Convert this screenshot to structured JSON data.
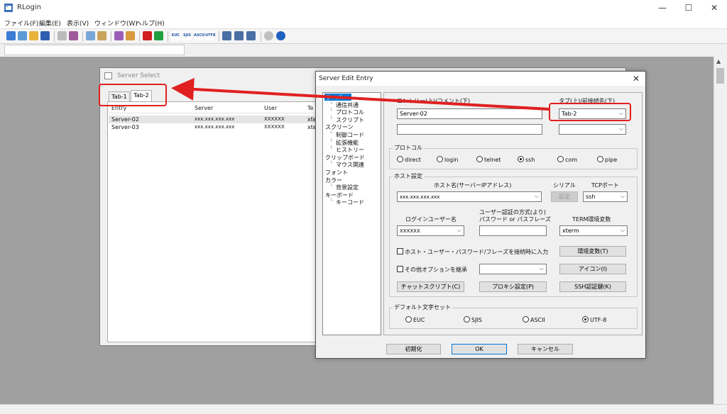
{
  "app": {
    "title": "RLogin",
    "menu": [
      "ファイル(F)",
      "編集(E)",
      "表示(V)",
      "ウィンドウ(W)",
      "ヘルプ(H)"
    ],
    "window_controls": {
      "minimize": "—",
      "maximize": "☐",
      "close": "✕"
    }
  },
  "toolbar": {
    "buttons": [
      {
        "icon": "new-connection-icon",
        "color": "#3a7bd5"
      },
      {
        "icon": "quick-connect-icon",
        "color": "#5b9bd5"
      },
      {
        "icon": "open-folder-icon",
        "color": "#e8b33c"
      },
      {
        "icon": "save-icon",
        "color": "#2f5fb3"
      },
      {
        "icon": "new-document-icon",
        "color": "#bbbbbb"
      },
      {
        "icon": "disconnect-icon",
        "color": "#a05a9c"
      },
      {
        "icon": "copy-icon",
        "color": "#7aa7d8"
      },
      {
        "icon": "paste-icon",
        "color": "#c8a45a"
      },
      {
        "icon": "script-icon",
        "color": "#9c5fb5"
      },
      {
        "icon": "keyboard-icon",
        "color": "#d89a3c"
      },
      {
        "icon": "stop-icon",
        "color": "#d02020"
      },
      {
        "icon": "play-icon",
        "color": "#20a040"
      }
    ],
    "charset_buttons": [
      "EUC",
      "SJIS",
      "ASCII",
      "UTF8"
    ],
    "view_buttons": [
      {
        "icon": "window-icon",
        "color": "#4a6fa5"
      },
      {
        "icon": "split-window-icon",
        "color": "#4a6fa5"
      },
      {
        "icon": "tile-window-icon",
        "color": "#4a6fa5"
      }
    ],
    "misc_buttons": [
      {
        "icon": "settings-icon",
        "color": "#c0c0c0"
      },
      {
        "icon": "help-icon",
        "color": "#2060c0"
      }
    ]
  },
  "server_select": {
    "title": "Server Select",
    "tabs": [
      "Tab-1",
      "Tab-2"
    ],
    "columns": [
      "Entry",
      "Server",
      "User",
      "Te"
    ],
    "rows": [
      {
        "entry": "Server-02",
        "server": "xxx.xxx.xxx.xxx",
        "user": "XXXXXX",
        "term": "xte"
      },
      {
        "entry": "Server-03",
        "server": "xxx.xxx.xxx.xxx",
        "user": "XXXXXX",
        "term": "xte"
      }
    ]
  },
  "edit_dialog": {
    "title": "Server Edit Entry",
    "close": "✕",
    "tree": [
      {
        "label": "サーバー",
        "level": 0
      },
      {
        "label": "通信共通",
        "level": 1
      },
      {
        "label": "プロトコル",
        "level": 1
      },
      {
        "label": "スクリプト",
        "level": 1
      },
      {
        "label": "スクリーン",
        "level": 0
      },
      {
        "label": "制御コード",
        "level": 1
      },
      {
        "label": "拡張機能",
        "level": 1
      },
      {
        "label": "ヒストリー",
        "level": 1
      },
      {
        "label": "クリップボード",
        "level": 0
      },
      {
        "label": "マウス関連",
        "level": 1
      },
      {
        "label": "フォント",
        "level": 0
      },
      {
        "label": "カラー",
        "level": 0
      },
      {
        "label": "背景設定",
        "level": 1
      },
      {
        "label": "キーボード",
        "level": 0
      },
      {
        "label": "キーコード",
        "level": 1
      }
    ],
    "entry_label": "エントリー(上)/コメント(下)",
    "entry_value": "Server-02",
    "comment_value": "",
    "tab_label": "タブ(上)/前接続先(下)",
    "tab_value": "Tab-2",
    "prev_value": "",
    "protocol_group": "プロトコル",
    "protocols": [
      {
        "label": "direct",
        "checked": false
      },
      {
        "label": "login",
        "checked": false
      },
      {
        "label": "telnet",
        "checked": false
      },
      {
        "label": "ssh",
        "checked": true
      },
      {
        "label": "com",
        "checked": false
      },
      {
        "label": "pipe",
        "checked": false
      }
    ],
    "host_group": "ホスト設定",
    "hostname_label": "ホスト名(サーバーIPアドレス)",
    "hostname_value": "xxx.xxx.xxx.xxx",
    "serial_label": "シリアル",
    "serial_button": "設定",
    "tcpport_label": "TCPポート",
    "tcpport_value": "ssh",
    "login_user_label": "ログインユーザー名",
    "login_user_value": "XXXXXX",
    "auth_label_1": "ユーザー認証の方式(より)",
    "auth_label_2": "パスワード or パスフレーズ",
    "password_value": "",
    "term_label": "TERM環境変数",
    "term_value": "xterm",
    "check_prompt": "ホスト・ユーザー・パスワード/フレーズを接続時に入力",
    "env_button": "環境変数(T)",
    "check_inherit": "その他オプションを継承",
    "inherit_value": "",
    "icon_button": "アイコン(I)",
    "chat_button": "チャットスクリプト(C)",
    "proxy_button": "プロキシ設定(P)",
    "sshkey_button": "SSH認証鍵(K)",
    "charset_group": "デフォルト文字セット",
    "charsets": [
      {
        "label": "EUC",
        "checked": false
      },
      {
        "label": "SJIS",
        "checked": false
      },
      {
        "label": "ASCII",
        "checked": false
      },
      {
        "label": "UTF-8",
        "checked": true
      }
    ],
    "init_button": "初期化",
    "ok_button": "OK",
    "cancel_button": "キャンセル"
  },
  "annotation": {
    "color": "#e02020"
  }
}
